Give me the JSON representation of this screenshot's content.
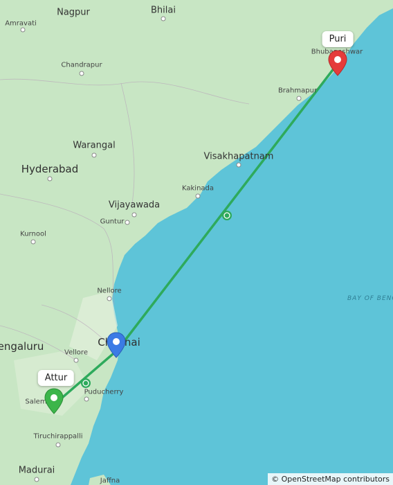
{
  "map": {
    "sea_label": "BAY OF BENG",
    "cities": {
      "nagpur": "Nagpur",
      "bhilai": "Bhilai",
      "amravati": "Amravati",
      "chandrapur": "Chandrapur",
      "warangal": "Warangal",
      "hyderabad": "Hyderabad",
      "brahmapur": "Brahmapur",
      "bhubaneswar": "Bhubaneshwar",
      "visakhapatnam": "Visakhapatnam",
      "kakinada": "Kakinada",
      "vijayawada": "Vijayawada",
      "guntur": "Guntur",
      "kurnool": "Kurnool",
      "nellore": "Nellore",
      "bengaluru": "engaluru",
      "vellore": "Vellore",
      "chennai": "Chennai",
      "salem": "Salem",
      "puducherry": "Puducherry",
      "tiruchirappalli": "Tiruchirappalli",
      "madurai": "Madurai",
      "jaffna": "Jaffna"
    },
    "markers": {
      "start_label": "Attur",
      "end_label": "Puri"
    },
    "colors": {
      "sea": "#5ec4d8",
      "land": "#c8e6c4",
      "route": "#2eaa5c",
      "start_pin": "#3cb54a",
      "end_pin": "#e53b3b",
      "waypoint_pin": "#3b7be5"
    },
    "attribution": "© OpenStreetMap contributors"
  }
}
